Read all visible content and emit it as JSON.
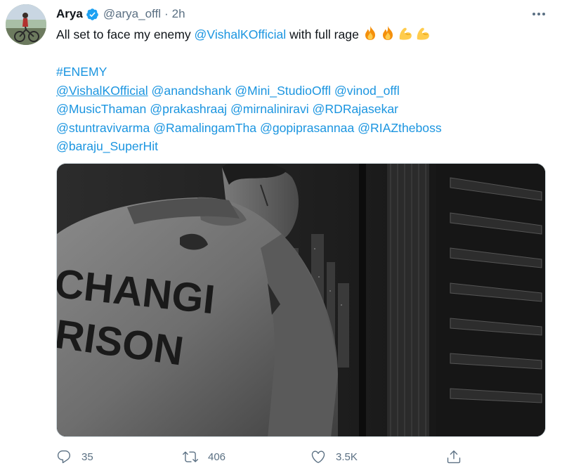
{
  "author": {
    "name": "Arya",
    "handle": "@arya_offl",
    "separator": "·",
    "time": "2h",
    "verified": true
  },
  "tweet": {
    "line1_text": "All set to face my enemy ",
    "line1_mention": "@VishalKOfficial",
    "line1_tail": " with full rage",
    "line1_emojis": [
      "fire-emoji",
      "fire-emoji",
      "flexed-biceps-emoji",
      "flexed-biceps-emoji"
    ],
    "hashtag": "#ENEMY",
    "mentions_line1": [
      "@VishalKOfficial",
      "@anandshank",
      "@Mini_StudioOffl",
      "@vinod_offl"
    ],
    "mentions_line2": [
      "@MusicThaman",
      "@prakashraaj",
      "@mirnaliniravi",
      "@RDRajasekar"
    ],
    "mentions_line3": [
      "@stuntravivarma",
      "@RamalingamTha",
      "@gopiprasannaa",
      "@RIAZtheboss"
    ],
    "mentions_line4": [
      "@baraju_SuperHit"
    ]
  },
  "media": {
    "jacket_text_line1": "CHANGI",
    "jacket_text_line2": "RISON"
  },
  "actions": {
    "replies": "35",
    "retweets": "406",
    "likes": "3.5K"
  },
  "colors": {
    "link": "#1b95e0",
    "muted": "#5b7083",
    "verified": "#1da1f2"
  }
}
